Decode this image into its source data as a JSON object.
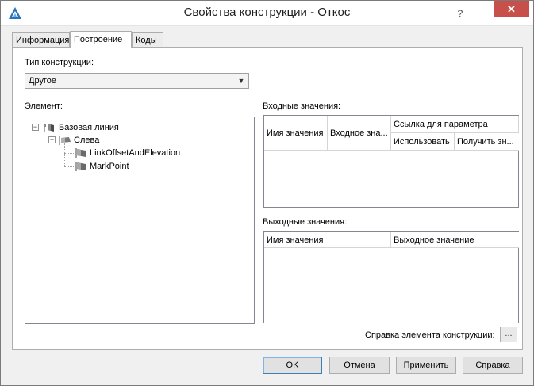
{
  "window": {
    "title": "Свойства конструкции - Откос",
    "help_glyph": "?",
    "close_glyph": "✕"
  },
  "tabs": [
    {
      "label": "Информация",
      "active": false
    },
    {
      "label": "Построение",
      "active": true
    },
    {
      "label": "Коды",
      "active": false
    }
  ],
  "construction_type": {
    "label": "Тип конструкции:",
    "value": "Другое"
  },
  "element": {
    "label": "Элемент:",
    "tree": [
      {
        "label": "Базовая линия",
        "icon": "baseline-icon",
        "expander": "−"
      },
      {
        "label": "Слева",
        "icon": "side-icon",
        "expander": "−"
      },
      {
        "label": "LinkOffsetAndElevation",
        "icon": "flag-icon"
      },
      {
        "label": "MarkPoint",
        "icon": "flag-icon"
      }
    ]
  },
  "input_values": {
    "label": "Входные значения:",
    "columns": {
      "name": "Имя значения",
      "input": "Входное зна...",
      "param_ref": "Ссылка для параметра",
      "use": "Использовать",
      "get": "Получить зн..."
    },
    "rows": []
  },
  "output_values": {
    "label": "Выходные значения:",
    "columns": {
      "name": "Имя значения",
      "output": "Выходное значение"
    },
    "rows": []
  },
  "element_help": {
    "label": "Справка элемента конструкции:",
    "button": "..."
  },
  "buttons": {
    "ok": "OK",
    "cancel": "Отмена",
    "apply": "Применить",
    "help": "Справка"
  }
}
